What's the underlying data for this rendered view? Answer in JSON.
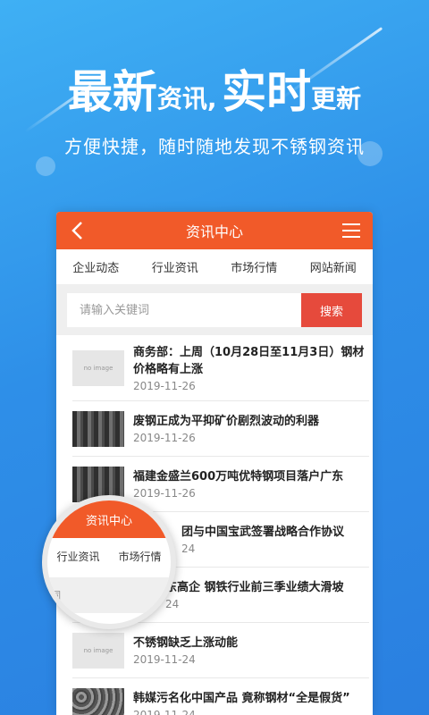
{
  "promo": {
    "headline_big1": "最新",
    "headline_small1": "资讯,",
    "headline_big2": "实时",
    "headline_small2": "更新",
    "subline": "方便快捷，随时随地发现不锈钢资讯"
  },
  "app": {
    "title": "资讯中心",
    "tabs": [
      "企业动态",
      "行业资讯",
      "市场行情",
      "网站新闻"
    ],
    "search": {
      "placeholder": "请输入关键词",
      "button": "搜索"
    },
    "no_image_text": "no image",
    "items": [
      {
        "title": "商务部：上周（10月28日至11月3日）钢材价格略有上涨",
        "date": "2019-11-26"
      },
      {
        "title": "废钢正成为平抑矿价剧烈波动的利器",
        "date": "2019-11-26"
      },
      {
        "title": "福建金盛兰600万吨优特钢项目落户广东",
        "date": "2019-11-26"
      },
      {
        "title": "团与中国宝武签署战略合作协议",
        "date": "24"
      },
      {
        "title": "东高企 钢铁行业前三季业绩大滑坡",
        "date": "24"
      },
      {
        "title": "不锈钢缺乏上涨动能",
        "date": "2019-11-24"
      },
      {
        "title": "韩媒污名化中国产品 竟称钢材“全是假货”",
        "date": "2019-11-24"
      }
    ]
  },
  "magnifier": {
    "title": "资讯中心",
    "tabs": [
      "行业资讯",
      "市场行情"
    ],
    "search_fragment": "词",
    "line_fragment": "上周（10月"
  }
}
